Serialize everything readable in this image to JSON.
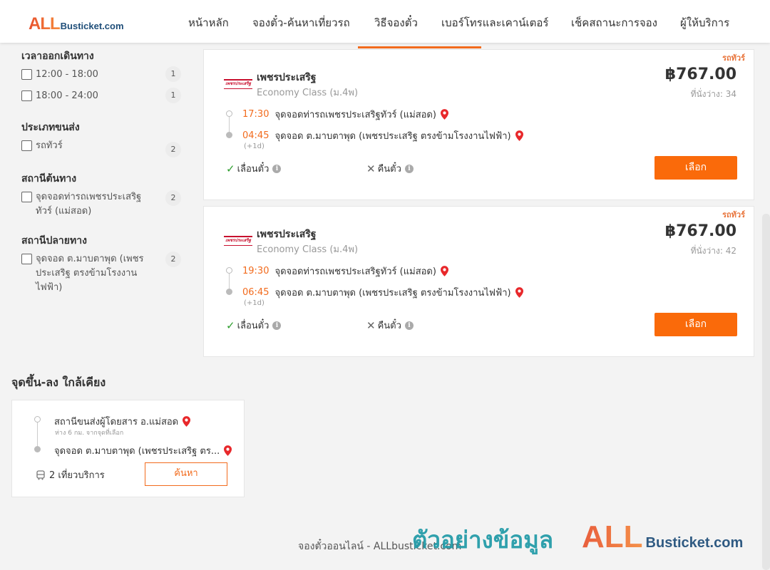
{
  "header": {
    "logo_all": "ALL",
    "logo_rest": "Busticket.com",
    "nav": [
      "หน้าหลัก",
      "จองตั๋ว-ค้นหาเที่ยวรถ",
      "วิธีจองตั๋ว",
      "เบอร์โทรและเคาน์เตอร์",
      "เช็คสถานะการจอง",
      "ผู้ให้บริการ"
    ]
  },
  "filters": {
    "departure_time": {
      "title": "เวลาออกเดินทาง",
      "options": [
        {
          "label": "12:00 - 18:00",
          "count": "1"
        },
        {
          "label": "18:00 - 24:00",
          "count": "1"
        }
      ]
    },
    "transport_type": {
      "title": "ประเภทขนส่ง",
      "options": [
        {
          "label": "รถทัวร์",
          "count": "2"
        }
      ]
    },
    "origin": {
      "title": "สถานีต้นทาง",
      "options": [
        {
          "label": "จุดจอดท่ารถเพชรประเสริฐทัวร์ (แม่สอด)",
          "count": "2"
        }
      ]
    },
    "destination": {
      "title": "สถานีปลายทาง",
      "options": [
        {
          "label": "จุดจอด ต.มาบตาพุด (เพชรประเสริฐ ตรงข้ามโรงงานไฟฟ้า)",
          "count": "2"
        }
      ]
    }
  },
  "trips": [
    {
      "tag": "รถทัวร์",
      "logo_text": "เพชรประเสริฐ",
      "operator": "เพชรประเสริฐ",
      "class": "Economy Class (ม.4พ)",
      "price": "฿767.00",
      "seats": "ที่นั่งว่าง: 34",
      "depart_time": "17:30",
      "depart_stop": "จุดจอดท่ารถเพชรประเสริฐทัวร์ (แม่สอด)",
      "arrive_time": "04:45",
      "arrive_stop": "จุดจอด ต.มาบตาพุด (เพชรประเสริฐ ตรงข้ามโรงงานไฟฟ้า)",
      "plus_day": "(+1d)",
      "reschedule": "เลื่อนตั๋ว",
      "refund": "คืนตั๋ว",
      "select": "เลือก"
    },
    {
      "tag": "รถทัวร์",
      "logo_text": "เพชรประเสริฐ",
      "operator": "เพชรประเสริฐ",
      "class": "Economy Class (ม.4พ)",
      "price": "฿767.00",
      "seats": "ที่นั่งว่าง: 42",
      "depart_time": "19:30",
      "depart_stop": "จุดจอดท่ารถเพชรประเสริฐทัวร์ (แม่สอด)",
      "arrive_time": "06:45",
      "arrive_stop": "จุดจอด ต.มาบตาพุด (เพชรประเสริฐ ตรงข้ามโรงงานไฟฟ้า)",
      "plus_day": "(+1d)",
      "reschedule": "เลื่อนตั๋ว",
      "refund": "คืนตั๋ว",
      "select": "เลือก"
    }
  ],
  "nearby": {
    "title": "จุดขึ้น-ลง ใกล้เคียง",
    "from_stop": "สถานีขนส่งผู้โดยสาร อ.แม่สอด",
    "from_distance": "ห่าง 6 กม. จากจุดที่เลือก",
    "to_stop": "จุดจอด ต.มาบตาพุด (เพชรประเสริฐ ตร...",
    "trips": "2 เที่ยวบริการ",
    "search": "ค้นหา"
  },
  "footer": {
    "text": "จองตั๋วออนไลน์ - ALLbusticket.com"
  },
  "watermark": {
    "thai": "ตัวอย่างข้อมูล",
    "logo_all": "ALL",
    "logo_rest": "Busticket.com"
  },
  "colors": {
    "accent": "#fa6a0a",
    "time": "#f26b1d",
    "pin": "#e8282b",
    "check": "#2e9e2e",
    "watermark_teal": "#1f99a7"
  }
}
